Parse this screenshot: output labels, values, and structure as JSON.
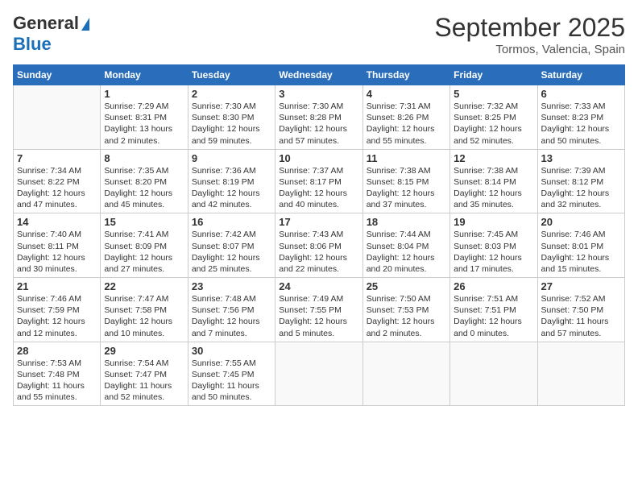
{
  "header": {
    "logo_general": "General",
    "logo_blue": "Blue",
    "title": "September 2025",
    "subtitle": "Tormos, Valencia, Spain"
  },
  "days_of_week": [
    "Sunday",
    "Monday",
    "Tuesday",
    "Wednesday",
    "Thursday",
    "Friday",
    "Saturday"
  ],
  "weeks": [
    [
      {
        "day": "",
        "sunrise": "",
        "sunset": "",
        "daylight": ""
      },
      {
        "day": "1",
        "sunrise": "Sunrise: 7:29 AM",
        "sunset": "Sunset: 8:31 PM",
        "daylight": "Daylight: 13 hours and 2 minutes."
      },
      {
        "day": "2",
        "sunrise": "Sunrise: 7:30 AM",
        "sunset": "Sunset: 8:30 PM",
        "daylight": "Daylight: 12 hours and 59 minutes."
      },
      {
        "day": "3",
        "sunrise": "Sunrise: 7:30 AM",
        "sunset": "Sunset: 8:28 PM",
        "daylight": "Daylight: 12 hours and 57 minutes."
      },
      {
        "day": "4",
        "sunrise": "Sunrise: 7:31 AM",
        "sunset": "Sunset: 8:26 PM",
        "daylight": "Daylight: 12 hours and 55 minutes."
      },
      {
        "day": "5",
        "sunrise": "Sunrise: 7:32 AM",
        "sunset": "Sunset: 8:25 PM",
        "daylight": "Daylight: 12 hours and 52 minutes."
      },
      {
        "day": "6",
        "sunrise": "Sunrise: 7:33 AM",
        "sunset": "Sunset: 8:23 PM",
        "daylight": "Daylight: 12 hours and 50 minutes."
      }
    ],
    [
      {
        "day": "7",
        "sunrise": "Sunrise: 7:34 AM",
        "sunset": "Sunset: 8:22 PM",
        "daylight": "Daylight: 12 hours and 47 minutes."
      },
      {
        "day": "8",
        "sunrise": "Sunrise: 7:35 AM",
        "sunset": "Sunset: 8:20 PM",
        "daylight": "Daylight: 12 hours and 45 minutes."
      },
      {
        "day": "9",
        "sunrise": "Sunrise: 7:36 AM",
        "sunset": "Sunset: 8:19 PM",
        "daylight": "Daylight: 12 hours and 42 minutes."
      },
      {
        "day": "10",
        "sunrise": "Sunrise: 7:37 AM",
        "sunset": "Sunset: 8:17 PM",
        "daylight": "Daylight: 12 hours and 40 minutes."
      },
      {
        "day": "11",
        "sunrise": "Sunrise: 7:38 AM",
        "sunset": "Sunset: 8:15 PM",
        "daylight": "Daylight: 12 hours and 37 minutes."
      },
      {
        "day": "12",
        "sunrise": "Sunrise: 7:38 AM",
        "sunset": "Sunset: 8:14 PM",
        "daylight": "Daylight: 12 hours and 35 minutes."
      },
      {
        "day": "13",
        "sunrise": "Sunrise: 7:39 AM",
        "sunset": "Sunset: 8:12 PM",
        "daylight": "Daylight: 12 hours and 32 minutes."
      }
    ],
    [
      {
        "day": "14",
        "sunrise": "Sunrise: 7:40 AM",
        "sunset": "Sunset: 8:11 PM",
        "daylight": "Daylight: 12 hours and 30 minutes."
      },
      {
        "day": "15",
        "sunrise": "Sunrise: 7:41 AM",
        "sunset": "Sunset: 8:09 PM",
        "daylight": "Daylight: 12 hours and 27 minutes."
      },
      {
        "day": "16",
        "sunrise": "Sunrise: 7:42 AM",
        "sunset": "Sunset: 8:07 PM",
        "daylight": "Daylight: 12 hours and 25 minutes."
      },
      {
        "day": "17",
        "sunrise": "Sunrise: 7:43 AM",
        "sunset": "Sunset: 8:06 PM",
        "daylight": "Daylight: 12 hours and 22 minutes."
      },
      {
        "day": "18",
        "sunrise": "Sunrise: 7:44 AM",
        "sunset": "Sunset: 8:04 PM",
        "daylight": "Daylight: 12 hours and 20 minutes."
      },
      {
        "day": "19",
        "sunrise": "Sunrise: 7:45 AM",
        "sunset": "Sunset: 8:03 PM",
        "daylight": "Daylight: 12 hours and 17 minutes."
      },
      {
        "day": "20",
        "sunrise": "Sunrise: 7:46 AM",
        "sunset": "Sunset: 8:01 PM",
        "daylight": "Daylight: 12 hours and 15 minutes."
      }
    ],
    [
      {
        "day": "21",
        "sunrise": "Sunrise: 7:46 AM",
        "sunset": "Sunset: 7:59 PM",
        "daylight": "Daylight: 12 hours and 12 minutes."
      },
      {
        "day": "22",
        "sunrise": "Sunrise: 7:47 AM",
        "sunset": "Sunset: 7:58 PM",
        "daylight": "Daylight: 12 hours and 10 minutes."
      },
      {
        "day": "23",
        "sunrise": "Sunrise: 7:48 AM",
        "sunset": "Sunset: 7:56 PM",
        "daylight": "Daylight: 12 hours and 7 minutes."
      },
      {
        "day": "24",
        "sunrise": "Sunrise: 7:49 AM",
        "sunset": "Sunset: 7:55 PM",
        "daylight": "Daylight: 12 hours and 5 minutes."
      },
      {
        "day": "25",
        "sunrise": "Sunrise: 7:50 AM",
        "sunset": "Sunset: 7:53 PM",
        "daylight": "Daylight: 12 hours and 2 minutes."
      },
      {
        "day": "26",
        "sunrise": "Sunrise: 7:51 AM",
        "sunset": "Sunset: 7:51 PM",
        "daylight": "Daylight: 12 hours and 0 minutes."
      },
      {
        "day": "27",
        "sunrise": "Sunrise: 7:52 AM",
        "sunset": "Sunset: 7:50 PM",
        "daylight": "Daylight: 11 hours and 57 minutes."
      }
    ],
    [
      {
        "day": "28",
        "sunrise": "Sunrise: 7:53 AM",
        "sunset": "Sunset: 7:48 PM",
        "daylight": "Daylight: 11 hours and 55 minutes."
      },
      {
        "day": "29",
        "sunrise": "Sunrise: 7:54 AM",
        "sunset": "Sunset: 7:47 PM",
        "daylight": "Daylight: 11 hours and 52 minutes."
      },
      {
        "day": "30",
        "sunrise": "Sunrise: 7:55 AM",
        "sunset": "Sunset: 7:45 PM",
        "daylight": "Daylight: 11 hours and 50 minutes."
      },
      {
        "day": "",
        "sunrise": "",
        "sunset": "",
        "daylight": ""
      },
      {
        "day": "",
        "sunrise": "",
        "sunset": "",
        "daylight": ""
      },
      {
        "day": "",
        "sunrise": "",
        "sunset": "",
        "daylight": ""
      },
      {
        "day": "",
        "sunrise": "",
        "sunset": "",
        "daylight": ""
      }
    ]
  ]
}
